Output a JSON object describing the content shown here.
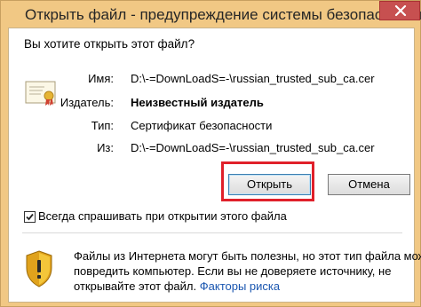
{
  "window": {
    "title": "Открыть файл - предупреждение системы безопасности"
  },
  "dialog": {
    "question": "Вы хотите открыть этот файл?",
    "fields": {
      "name_label": "Имя:",
      "name_value": "D:\\-=DownLoadS=-\\russian_trusted_sub_ca.cer",
      "publisher_label": "Издатель:",
      "publisher_value": "Неизвестный издатель",
      "type_label": "Тип:",
      "type_value": "Сертификат безопасности",
      "from_label": "Из:",
      "from_value": "D:\\-=DownLoadS=-\\russian_trusted_sub_ca.cer"
    },
    "buttons": {
      "open_label": "Открыть",
      "cancel_label": "Отмена"
    },
    "checkbox": {
      "label": "Всегда спрашивать при открытии этого файла",
      "checked": true
    },
    "warning": {
      "line1": "Файлы из Интернета могут быть полезны, но этот тип файла может",
      "line2": "повредить компьютер. Если вы не доверяете источнику, не",
      "line3_prefix": "открывайте этот файл.",
      "link_label": "Факторы риска"
    }
  },
  "colors": {
    "frame": "#f1c884",
    "close_button": "#c75050",
    "highlight_box": "#e0202a",
    "link": "#1a56b0"
  },
  "icons": [
    "close-icon",
    "certificate-icon",
    "checkmark-icon",
    "shield-warning-icon"
  ]
}
